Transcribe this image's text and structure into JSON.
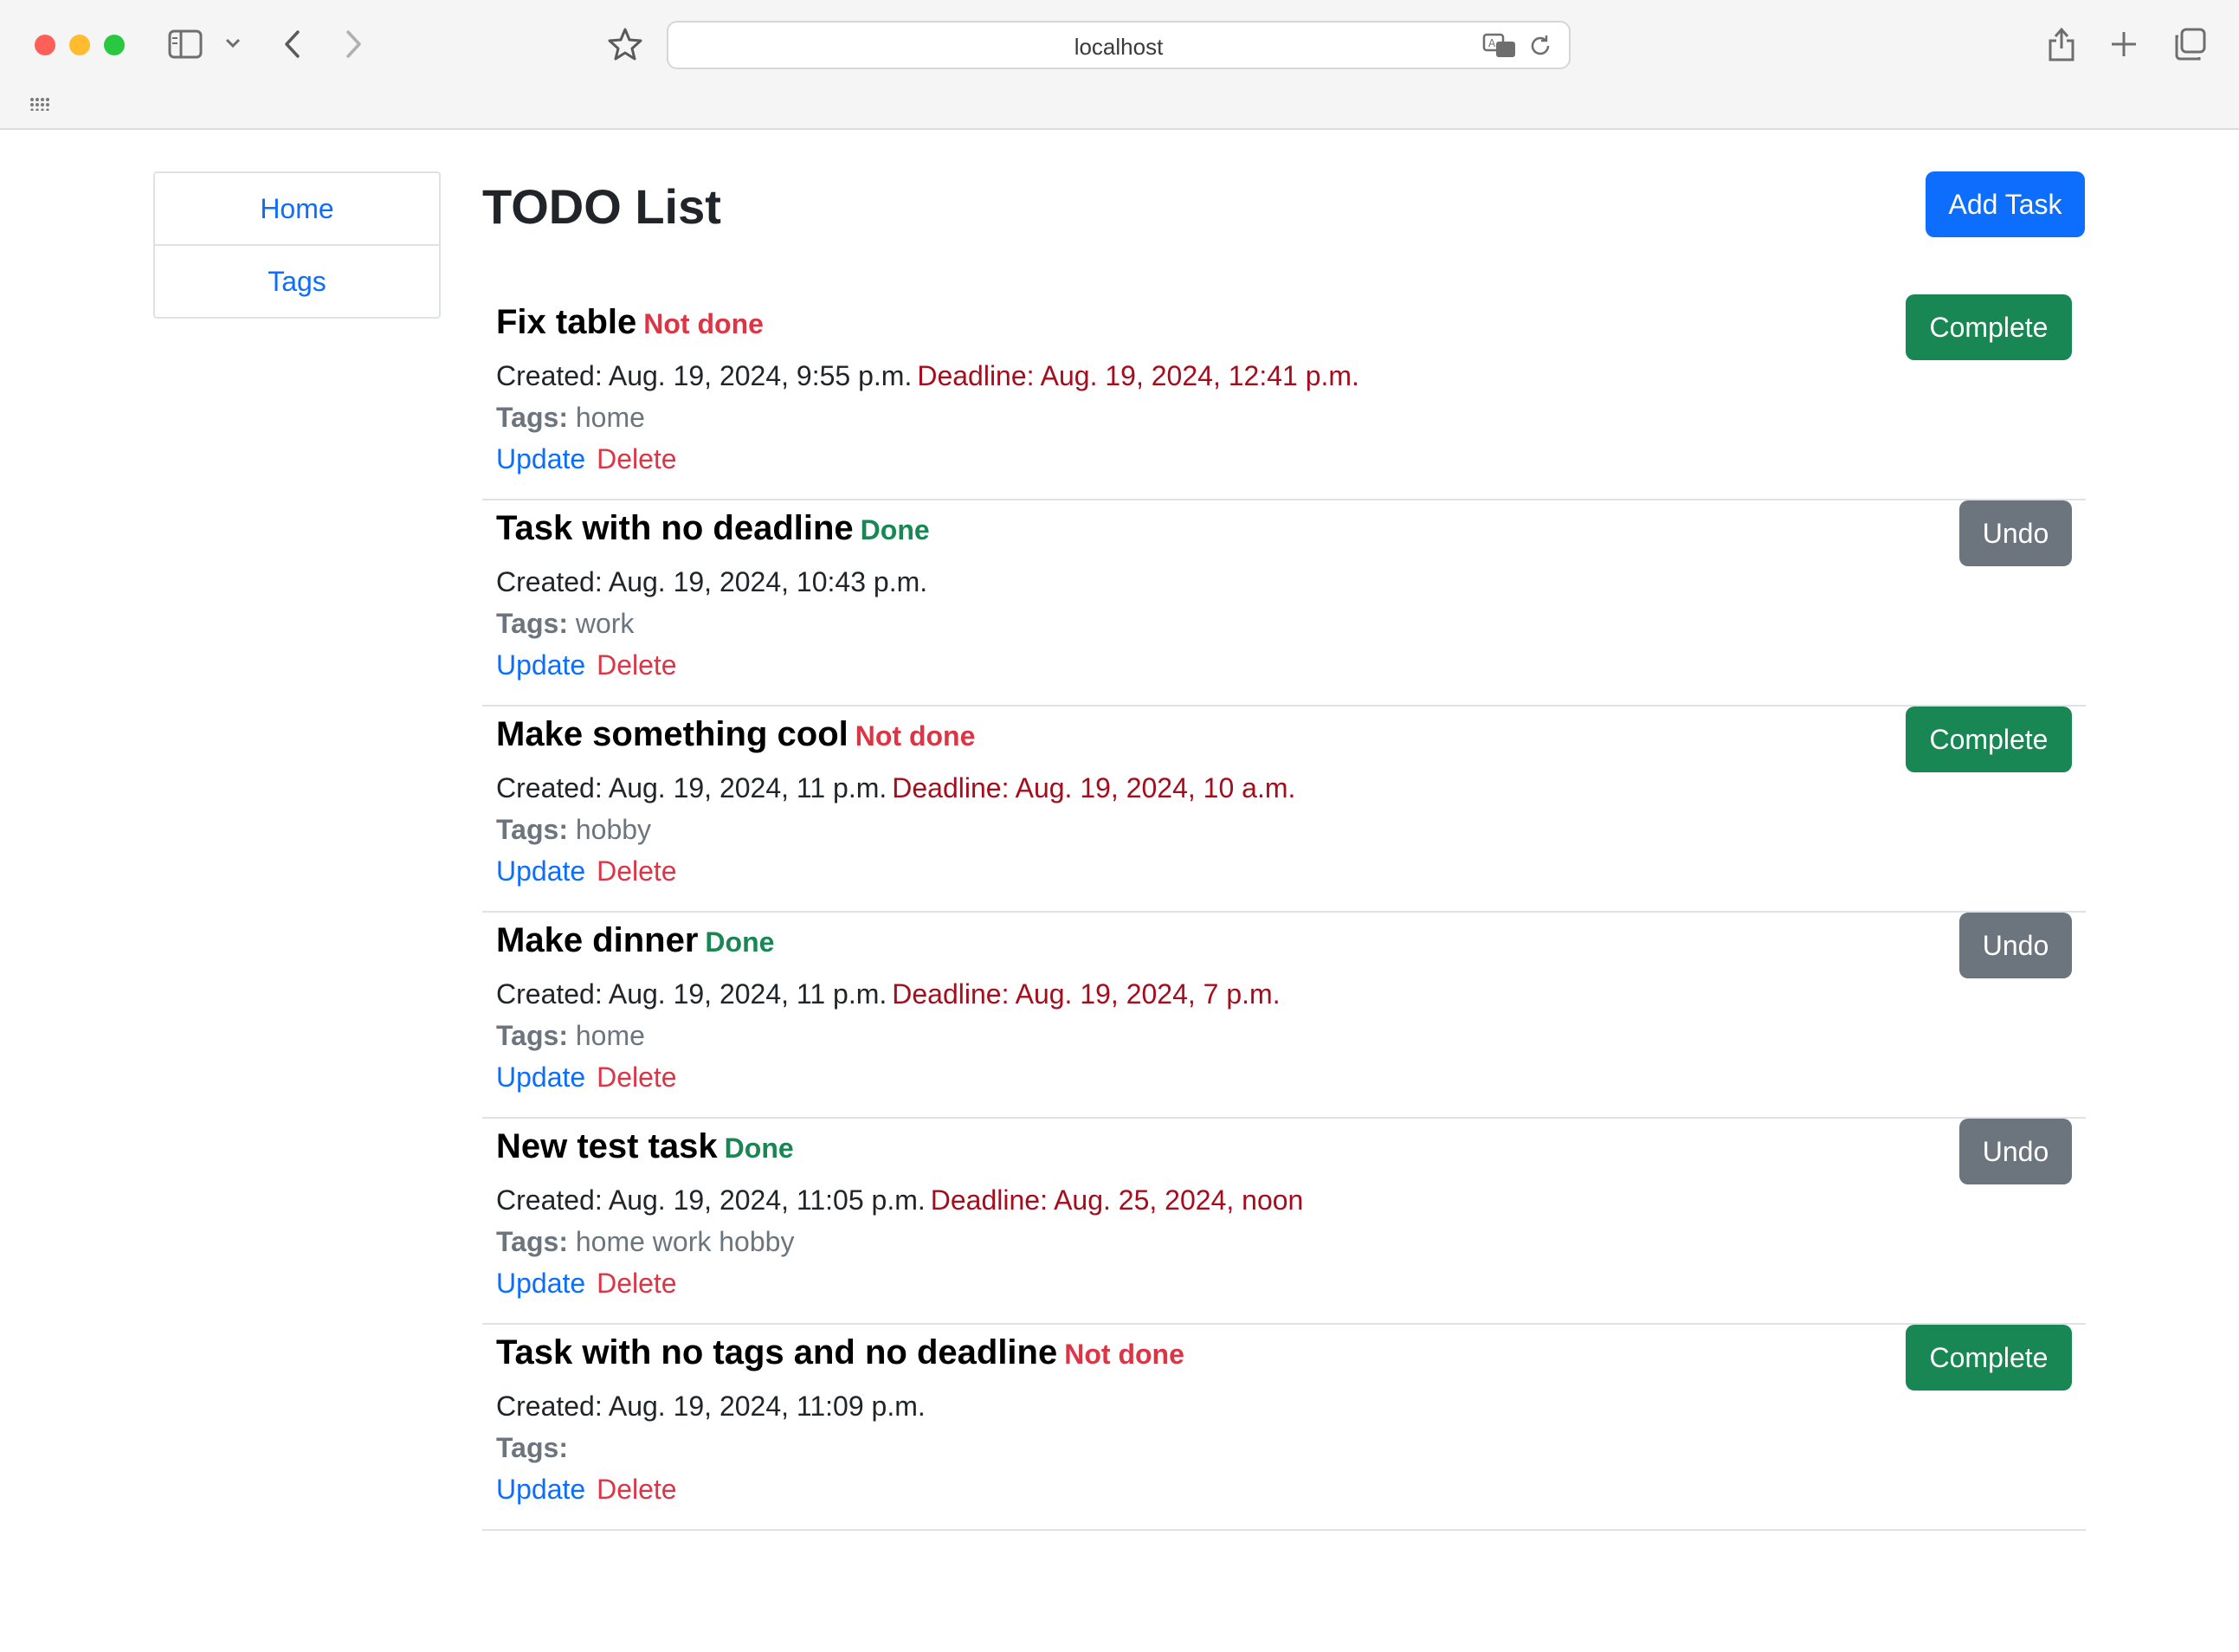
{
  "browser": {
    "url": "localhost"
  },
  "sidebar": {
    "items": [
      {
        "label": "Home"
      },
      {
        "label": "Tags"
      }
    ]
  },
  "page": {
    "title": "TODO List",
    "add_task_label": "Add Task"
  },
  "tasks": [
    {
      "title": "Fix table",
      "status": "Not done",
      "created": "Created: Aug. 19, 2024, 9:55 p.m.",
      "deadline": "Deadline: Aug. 19, 2024, 12:41 p.m.",
      "tags_label": "Tags:",
      "tags": "home",
      "update_label": "Update",
      "delete_label": "Delete",
      "action_label": "Complete"
    },
    {
      "title": "Task with no deadline",
      "status": "Done",
      "created": "Created: Aug. 19, 2024, 10:43 p.m.",
      "deadline": "",
      "tags_label": "Tags:",
      "tags": "work",
      "update_label": "Update",
      "delete_label": "Delete",
      "action_label": "Undo"
    },
    {
      "title": "Make something cool",
      "status": "Not done",
      "created": "Created: Aug. 19, 2024, 11 p.m.",
      "deadline": "Deadline: Aug. 19, 2024, 10 a.m.",
      "tags_label": "Tags:",
      "tags": "hobby",
      "update_label": "Update",
      "delete_label": "Delete",
      "action_label": "Complete"
    },
    {
      "title": "Make dinner",
      "status": "Done",
      "created": "Created: Aug. 19, 2024, 11 p.m.",
      "deadline": "Deadline: Aug. 19, 2024, 7 p.m.",
      "tags_label": "Tags:",
      "tags": "home",
      "update_label": "Update",
      "delete_label": "Delete",
      "action_label": "Undo"
    },
    {
      "title": "New test task",
      "status": "Done",
      "created": "Created: Aug. 19, 2024, 11:05 p.m.",
      "deadline": "Deadline: Aug. 25, 2024, noon",
      "tags_label": "Tags:",
      "tags": "home work hobby",
      "update_label": "Update",
      "delete_label": "Delete",
      "action_label": "Undo"
    },
    {
      "title": "Task with no tags and no deadline",
      "status": "Not done",
      "created": "Created: Aug. 19, 2024, 11:09 p.m.",
      "deadline": "",
      "tags_label": "Tags:",
      "tags": "",
      "update_label": "Update",
      "delete_label": "Delete",
      "action_label": "Complete"
    }
  ],
  "colors": {
    "primary": "#0d6efd",
    "success": "#198754",
    "danger": "#dc3545",
    "deadline": "#a50d1d",
    "secondary": "#6c757d"
  }
}
